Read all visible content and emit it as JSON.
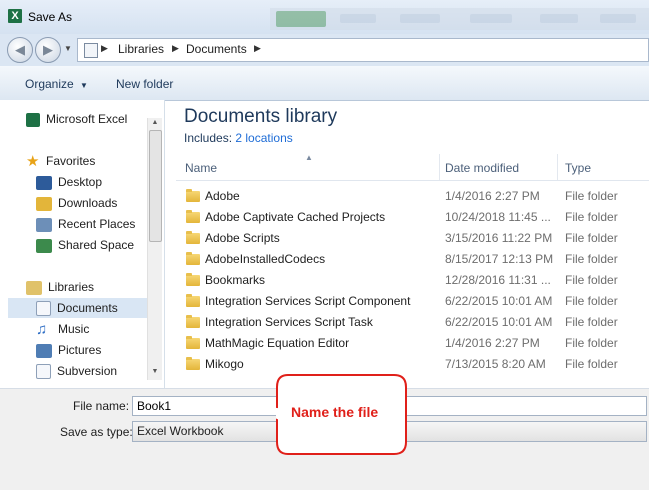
{
  "window": {
    "title": "Save As",
    "app_icon_letter": "X"
  },
  "address": {
    "crumbs": [
      "Libraries",
      "Documents"
    ]
  },
  "toolbar": {
    "organize_label": "Organize",
    "new_folder_label": "New folder"
  },
  "nav": {
    "app": "Microsoft Excel",
    "favorites_header": "Favorites",
    "favorites": [
      "Desktop",
      "Downloads",
      "Recent Places",
      "Shared Space"
    ],
    "libraries_header": "Libraries",
    "libraries": [
      "Documents",
      "Music",
      "Pictures",
      "Subversion"
    ]
  },
  "library": {
    "title": "Documents library",
    "includes_label": "Includes:",
    "includes_link": "2 locations"
  },
  "columns": [
    "Name",
    "Date modified",
    "Type"
  ],
  "files": [
    {
      "name": "Adobe",
      "date": "1/4/2016 2:27 PM",
      "type": "File folder"
    },
    {
      "name": "Adobe Captivate Cached Projects",
      "date": "10/24/2018 11:45 ...",
      "type": "File folder"
    },
    {
      "name": "Adobe Scripts",
      "date": "3/15/2016 11:22 PM",
      "type": "File folder"
    },
    {
      "name": "AdobeInstalledCodecs",
      "date": "8/15/2017 12:13 PM",
      "type": "File folder"
    },
    {
      "name": "Bookmarks",
      "date": "12/28/2016 11:31 ...",
      "type": "File folder"
    },
    {
      "name": "Integration Services Script Component",
      "date": "6/22/2015 10:01 AM",
      "type": "File folder"
    },
    {
      "name": "Integration Services Script Task",
      "date": "6/22/2015 10:01 AM",
      "type": "File folder"
    },
    {
      "name": "MathMagic Equation Editor",
      "date": "1/4/2016 2:27 PM",
      "type": "File folder"
    },
    {
      "name": "Mikogo",
      "date": "7/13/2015 8:20 AM",
      "type": "File folder"
    }
  ],
  "form": {
    "filename_label": "File name:",
    "filename_value": "Book1",
    "savetype_label": "Save as type:",
    "savetype_value": "Excel Workbook"
  },
  "callout": {
    "text": "Name the file"
  },
  "colors": {
    "excel_green": "#1e7145",
    "callout_red": "#e0201a",
    "link_blue": "#1e6cd6"
  }
}
